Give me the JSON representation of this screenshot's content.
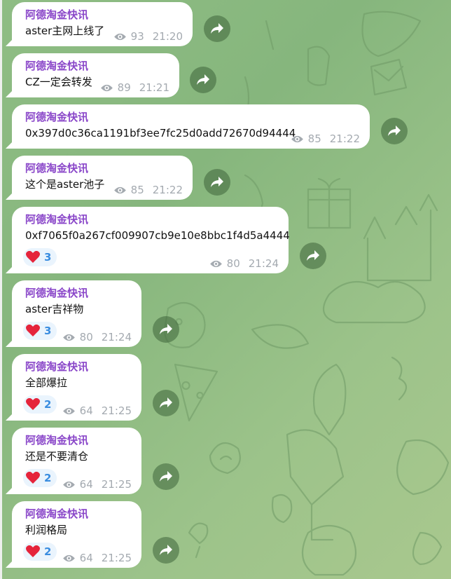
{
  "channel_sender": "阿德淘金快讯",
  "messages": [
    {
      "text": "aster主网上线了",
      "views": "93",
      "time": "21:20",
      "reaction": null
    },
    {
      "text": "CZ一定会转发",
      "views": "89",
      "time": "21:21",
      "reaction": null
    },
    {
      "text": "0x397d0c36ca1191bf3ee7fc25d0add72670d94444",
      "views": "85",
      "time": "21:22",
      "reaction": null
    },
    {
      "text": "这个是aster池子",
      "views": "85",
      "time": "21:22",
      "reaction": null
    },
    {
      "text": "0xf7065f0a267cf009907cb9e10e8bbc1f4d5a4444",
      "views": "80",
      "time": "21:24",
      "reaction": {
        "emoji": "heart-icon",
        "count": "3"
      }
    },
    {
      "text": "aster吉祥物",
      "views": "80",
      "time": "21:24",
      "reaction": {
        "emoji": "heart-icon",
        "count": "3"
      }
    },
    {
      "text": "全部爆拉",
      "views": "64",
      "time": "21:25",
      "reaction": {
        "emoji": "heart-icon",
        "count": "2"
      }
    },
    {
      "text": "还是不要清仓",
      "views": "64",
      "time": "21:25",
      "reaction": {
        "emoji": "heart-icon",
        "count": "2"
      }
    },
    {
      "text": "利润格局",
      "views": "64",
      "time": "21:25",
      "reaction": {
        "emoji": "heart-icon",
        "count": "2"
      }
    }
  ],
  "colors": {
    "sender": "#8a47c9",
    "meta": "#a4aab0",
    "reaction_bg": "#eaf4fd",
    "reaction_count": "#3a8de0",
    "heart": "#e5243b",
    "wallpaper": "#8fbd84"
  }
}
